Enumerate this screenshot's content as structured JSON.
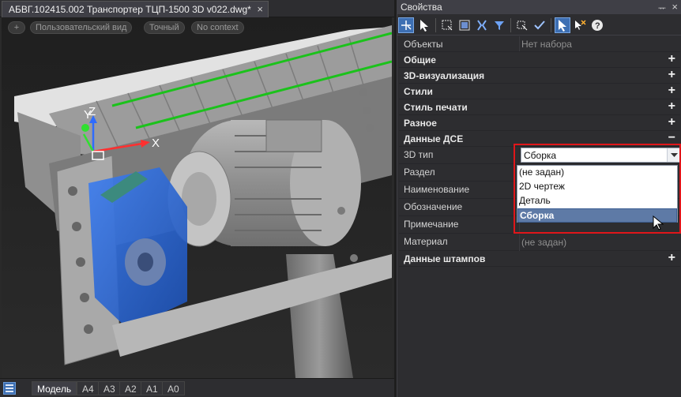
{
  "document": {
    "tab_title": "АБВГ.102415.002 Транспортер ТЦП-1500 3D v022.dwg*",
    "close_glyph": "×"
  },
  "viewport": {
    "add_pill": "+",
    "view_pill": "Пользовательский вид",
    "mode_pill": "Точный",
    "context_pill": "No context",
    "axis_labels": {
      "y": "Y",
      "z": "Z",
      "x": "X"
    },
    "colors": {
      "axis_x": "#ff3030",
      "axis_y": "#30e030",
      "axis_z": "#2f6bff",
      "gearbox": "#2a64d6",
      "belt_edge": "#1bc21b"
    }
  },
  "layouts": {
    "tabs": [
      "Модель",
      "A4",
      "A3",
      "A2",
      "A1",
      "A0"
    ],
    "active": "Модель"
  },
  "properties": {
    "title": "Свойства",
    "pin_glyph": "ᅲ",
    "close_glyph": "×",
    "objects_label": "Объекты",
    "objects_value": "Нет набора",
    "categories": {
      "general": "Общие",
      "viz3d": "3D-визуализация",
      "styles": "Стили",
      "print_style": "Стиль печати",
      "misc": "Разное",
      "dse": "Данные ДСЕ",
      "stamps": "Данные штампов"
    },
    "expand_glyph": "+",
    "collapse_glyph": "−",
    "fields": {
      "type3d_label": "3D тип",
      "type3d_value": "Сборка",
      "section_label": "Раздел",
      "name_label": "Наименование",
      "designation_label": "Обозначение",
      "note_label": "Примечание",
      "material_label": "Материал",
      "material_value": "(не задан)"
    },
    "dropdown_options": [
      "(не задан)",
      "2D чертеж",
      "Деталь",
      "Сборка"
    ],
    "dropdown_selected": "Сборка"
  }
}
